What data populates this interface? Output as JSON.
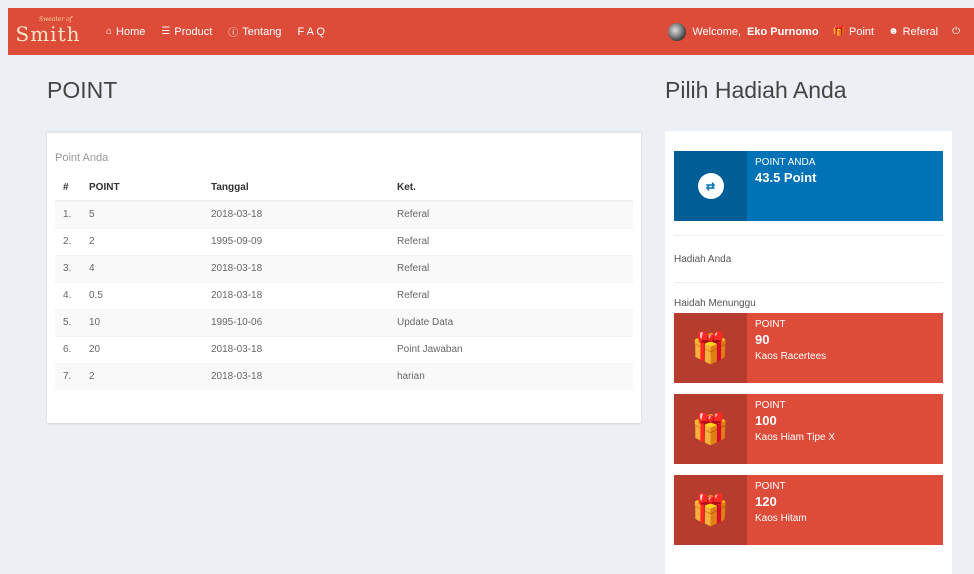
{
  "brand": {
    "small": "Sweater of",
    "main": "Smith"
  },
  "nav": {
    "home": "Home",
    "product": "Product",
    "tentang": "Tentang",
    "faq": "F A Q"
  },
  "user": {
    "welcome_prefix": "Welcome,",
    "name": "Eko Purnomo",
    "point": "Point",
    "referal": "Referal"
  },
  "page": {
    "title": "POINT",
    "side_title": "Pilih Hadiah Anda",
    "box_title": "Point Anda"
  },
  "table": {
    "headers": [
      "#",
      "POINT",
      "Tanggal",
      "Ket."
    ],
    "rows": [
      [
        "1.",
        "5",
        "2018-03-18",
        "Referal"
      ],
      [
        "2.",
        "2",
        "1995-09-09",
        "Referal"
      ],
      [
        "3.",
        "4",
        "2018-03-18",
        "Referal"
      ],
      [
        "4.",
        "0.5",
        "2018-03-18",
        "Referal"
      ],
      [
        "5.",
        "10",
        "1995-10-06",
        "Update Data"
      ],
      [
        "6.",
        "20",
        "2018-03-18",
        "Point Jawaban"
      ],
      [
        "7.",
        "2",
        "2018-03-18",
        "harian"
      ]
    ]
  },
  "side": {
    "point_label": "POINT ANDA",
    "point_value": "43.5 Point",
    "hadiah_anda": "Hadiah Anda",
    "hadiah_menunggu": "Haidah Menunggu",
    "rewards": [
      {
        "label": "POINT",
        "points": "90",
        "name": "Kaos Racertees"
      },
      {
        "label": "POINT",
        "points": "100",
        "name": "Kaos Hiam Tipe X"
      },
      {
        "label": "POINT",
        "points": "120",
        "name": "Kaos Hitam"
      }
    ]
  },
  "colors": {
    "navbar": "#dd4b39",
    "blue_box": "#0073b7",
    "red_box": "#dd4b39",
    "background": "#ecf0f5"
  },
  "icons": {
    "home": "home-icon",
    "product": "list-icon",
    "tentang": "info-icon",
    "point": "gift-icon",
    "referal": "user-plus-icon",
    "logout": "power-icon",
    "point_box": "exchange-icon",
    "reward": "gift-icon"
  }
}
